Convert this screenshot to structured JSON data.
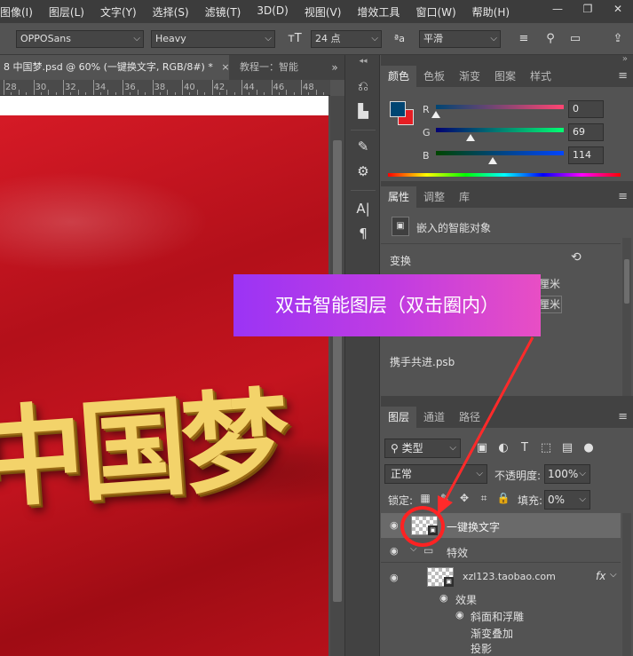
{
  "menu": {
    "items": [
      "图像(I)",
      "图层(L)",
      "文字(Y)",
      "选择(S)",
      "滤镜(T)",
      "3D(D)",
      "视图(V)",
      "增效工具",
      "窗口(W)",
      "帮助(H)"
    ]
  },
  "options_bar": {
    "font_family": "OPPOSans",
    "font_style": "Heavy",
    "font_size": "24 点",
    "anti_alias": "平滑"
  },
  "document_tabs": {
    "active": "8 中国梦.psd @ 60% (一键换文字, RGB/8#) *",
    "close": "×",
    "inactive": "教程一：智能",
    "more": "»"
  },
  "ruler": {
    "ticks": [
      "28",
      "30",
      "32",
      "34",
      "36",
      "38",
      "40",
      "42",
      "44",
      "46",
      "48"
    ]
  },
  "canvas": {
    "artwork_text": "中国梦"
  },
  "color_panel": {
    "tabs": [
      "颜色",
      "色板",
      "渐变",
      "图案",
      "样式"
    ],
    "foreground": "#004572",
    "background": "#e51d23",
    "channels": [
      {
        "label": "R",
        "value": "0"
      },
      {
        "label": "G",
        "value": "69"
      },
      {
        "label": "B",
        "value": "114"
      }
    ]
  },
  "properties_panel": {
    "tabs": [
      "属性",
      "调整",
      "库"
    ],
    "object_type": "嵌入的智能对象",
    "transform_label": "变换",
    "unit_1": "厘米",
    "unit_2": "厘米",
    "linked_file": "携手共进.psb"
  },
  "layers_panel": {
    "tabs": [
      "图层",
      "通道",
      "路径"
    ],
    "filter_type": "类型",
    "blend_mode": "正常",
    "opacity_label": "不透明度:",
    "opacity_value": "100%",
    "lock_label": "锁定:",
    "fill_label": "填充:",
    "fill_value": "0%",
    "layers": [
      {
        "name": "一键换文字"
      },
      {
        "name": "特效"
      },
      {
        "name": "xzl123.taobao.com",
        "fx": "fx"
      }
    ],
    "effects_label": "效果",
    "effects": [
      "斜面和浮雕",
      "渐变叠加",
      "投影"
    ]
  },
  "annotation": {
    "callout_text": "双击智能图层（双击圈内）"
  }
}
